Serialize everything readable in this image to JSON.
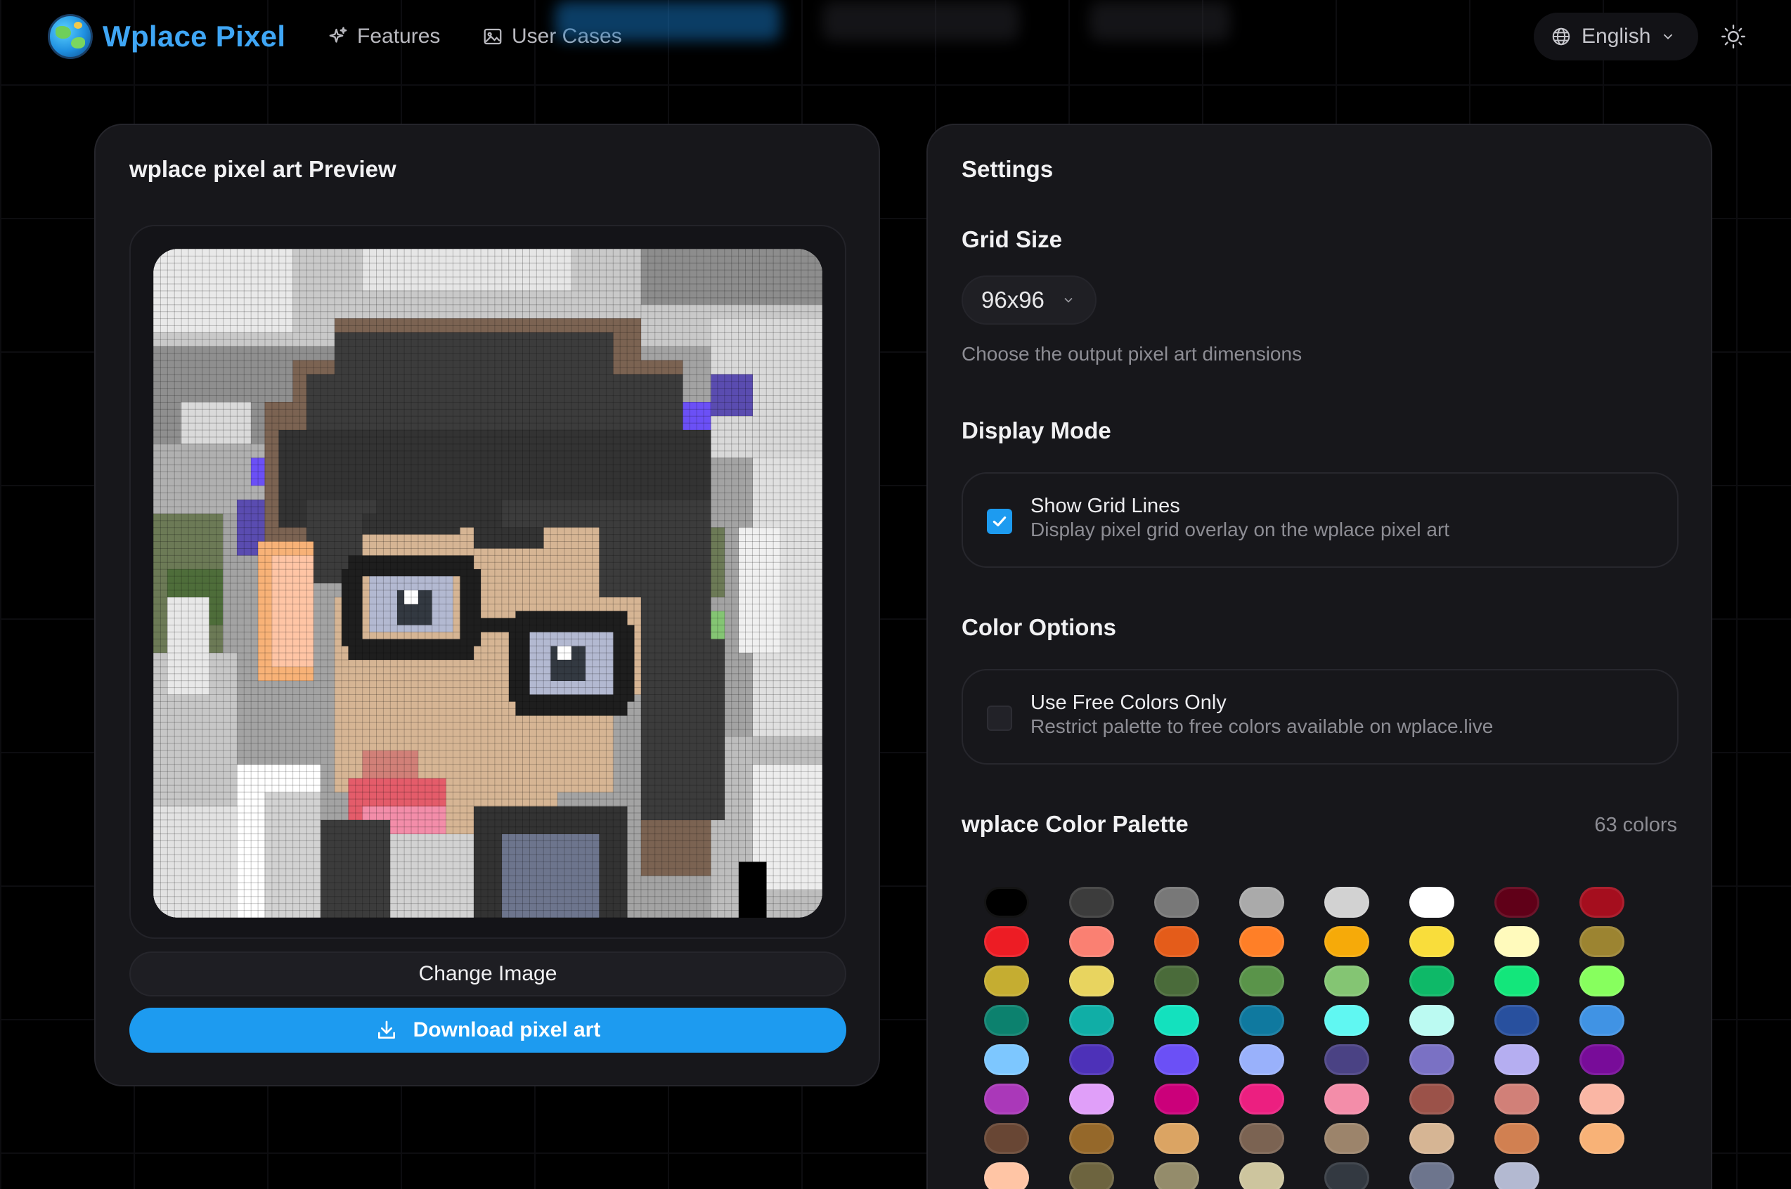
{
  "header": {
    "brand": "Wplace Pixel",
    "nav": [
      {
        "label": "Features",
        "icon": "sparkles-icon"
      },
      {
        "label": "User Cases",
        "icon": "image-icon"
      }
    ],
    "language": "English",
    "theme_icon": "sun-icon"
  },
  "preview": {
    "title": "wplace pixel art Preview",
    "change_button": "Change Image",
    "download_button": "Download pixel art"
  },
  "settings": {
    "title": "Settings",
    "grid_size": {
      "label": "Grid Size",
      "value": "96x96",
      "hint": "Choose the output pixel art dimensions"
    },
    "display_mode": {
      "label": "Display Mode",
      "option_title": "Show Grid Lines",
      "option_desc": "Display pixel grid overlay on the wplace pixel art",
      "checked": true
    },
    "color_options": {
      "label": "Color Options",
      "option_title": "Use Free Colors Only",
      "option_desc": "Restrict palette to free colors available on wplace.live",
      "checked": false
    },
    "palette": {
      "label": "wplace Color Palette",
      "count": "63 colors",
      "colors": [
        "#000000",
        "#3c3c3c",
        "#787878",
        "#aaaaaa",
        "#d2d2d2",
        "#ffffff",
        "#600018",
        "#a50e1e",
        "#ed1c24",
        "#fa8072",
        "#e45c1a",
        "#ff7f27",
        "#f6aa09",
        "#f9dd3b",
        "#fffabc",
        "#9c8431",
        "#c5ad31",
        "#e8d45f",
        "#4a6b3a",
        "#5a944a",
        "#84c573",
        "#0eb968",
        "#13e67b",
        "#87ff5e",
        "#0c816e",
        "#10aea6",
        "#13e1be",
        "#0f799f",
        "#60f7f2",
        "#bbfaf2",
        "#28509e",
        "#4093e4",
        "#7dc7ff",
        "#4d31b8",
        "#6b50f6",
        "#99b1fb",
        "#4a4284",
        "#7a71c4",
        "#b5aef1",
        "#780c99",
        "#aa38b9",
        "#e09ff9",
        "#cb007a",
        "#ec1f80",
        "#f38da9",
        "#9b5249",
        "#d18078",
        "#fab6a4",
        "#684634",
        "#95682a",
        "#dba463",
        "#7b6352",
        "#9c846b",
        "#d6b594",
        "#d18051",
        "#f8b277",
        "#ffc5a5",
        "#6d643f",
        "#948c6b",
        "#cdc59e",
        "#333941",
        "#6d758d",
        "#b3b9d1"
      ]
    }
  }
}
